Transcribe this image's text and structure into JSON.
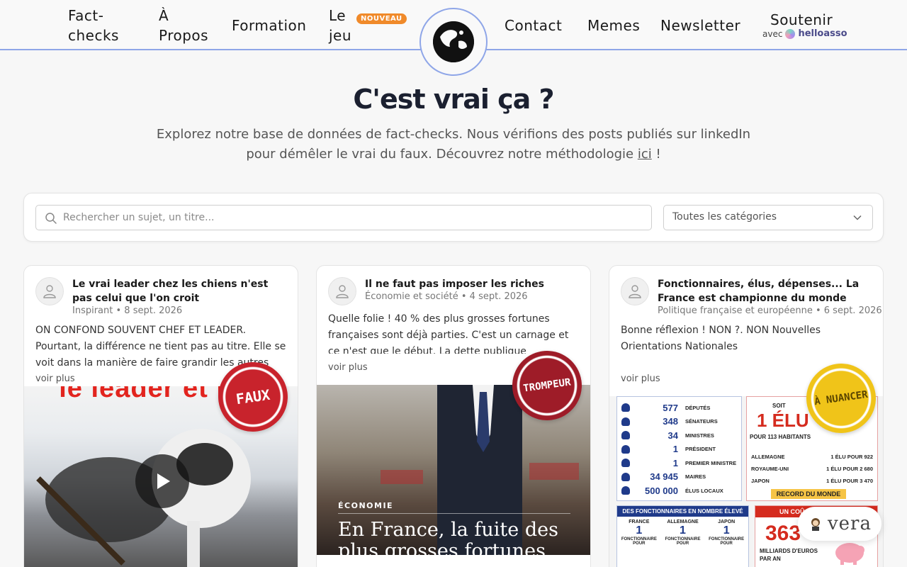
{
  "nav": {
    "fact_checks": "Fact-checks",
    "a_propos": "À Propos",
    "formation": "Formation",
    "le_jeu": "Le jeu",
    "nouveau_badge": "NOUVEAU",
    "contact": "Contact",
    "memes": "Memes",
    "newsletter": "Newsletter",
    "soutenir": "Soutenir",
    "soutenir_avec": "avec",
    "helloasso": "helloasso"
  },
  "hero": {
    "title": "C'est vrai ça ?",
    "subtitle": "Explorez notre base de données de fact-checks. Nous vérifions des posts publiés sur linkedIn pour démêler le vrai du faux. Découvrez notre méthodologie",
    "link": "ici",
    "suffix": " !"
  },
  "filters": {
    "search_placeholder": "Rechercher un sujet, un titre...",
    "category_selected": "Toutes les catégories"
  },
  "cards": [
    {
      "title": "Le vrai leader chez les chiens n'est pas celui que l'on croit",
      "category": "Inspirant",
      "date": "8 sept. 2026",
      "text": "ON CONFOND SOUVENT CHEF ET LEADER. Pourtant, la différence ne tient pas au titre. Elle se voit dans la manière de faire grandir les autres 🔹...",
      "voir_plus": "voir plus",
      "verdict": "FAUX",
      "image_caption": "le leader et le c"
    },
    {
      "title": "Il ne faut pas imposer les riches",
      "category": "Économie et société",
      "date": "4 sept. 2026",
      "text": "Quelle folie ! 40 % des plus grosses fortunes françaises sont déjà parties. C'est un carnage et ce n'est que le début. La dette publique française...",
      "voir_plus": "voir plus",
      "verdict": "TROMPEUR",
      "image_tag": "ÉCONOMIE",
      "image_headline": "En France, la fuite des plus grosses fortunes"
    },
    {
      "title": "Fonctionnaires, élus, dépenses... La France est championne du monde",
      "category": "Politique française et européenne",
      "date": "6 sept. 2026",
      "text": "Bonne réflexion ! NON ?. NON Nouvelles Orientations Nationales",
      "voir_plus": "voir plus",
      "verdict": "À NUANCER"
    }
  ],
  "infographic": {
    "rows": [
      {
        "value": "577",
        "label": "DÉPUTÉS"
      },
      {
        "value": "348",
        "label": "SÉNATEURS"
      },
      {
        "value": "34",
        "label": "MINISTRES"
      },
      {
        "value": "1",
        "label": "PRÉSIDENT"
      },
      {
        "value": "1",
        "label": "PREMIER MINISTRE"
      },
      {
        "value": "34 945",
        "label": "MAIRES"
      },
      {
        "value": "500 000",
        "label": "ÉLUS LOCAUX"
      }
    ],
    "soit": "SOIT",
    "big": "1 ÉLU",
    "per": "POUR 113 HABITANTS",
    "countries": [
      {
        "name": "ALLEMAGNE",
        "ratio": "1 ÉLU POUR 922"
      },
      {
        "name": "ROYAUME-UNI",
        "ratio": "1 ÉLU POUR 2 680"
      },
      {
        "name": "JAPON",
        "ratio": "1 ÉLU POUR 3 470"
      }
    ],
    "record": "RECORD DU MONDE",
    "fonctionnaires_title": "DES FONCTIONNAIRES EN NOMBRE ÉLEVÉ",
    "fonc_countries": [
      "FRANCE",
      "ALLEMAGNE",
      "JAPON"
    ],
    "fonc_value": "1",
    "fonc_label": "FONCTIONNAIRE POUR",
    "cout_title": "UN COÛ",
    "cout_value": "363",
    "cout_label": "MILLIARDS D'EUROS PAR AN"
  },
  "widget": {
    "vera": "vera"
  },
  "colors": {
    "accent_border": "#8fa6e8",
    "badge": "#f08a2a",
    "faux": "#c8232c",
    "trompeur": "#9e1c28",
    "nuancer": "#f0c419"
  }
}
